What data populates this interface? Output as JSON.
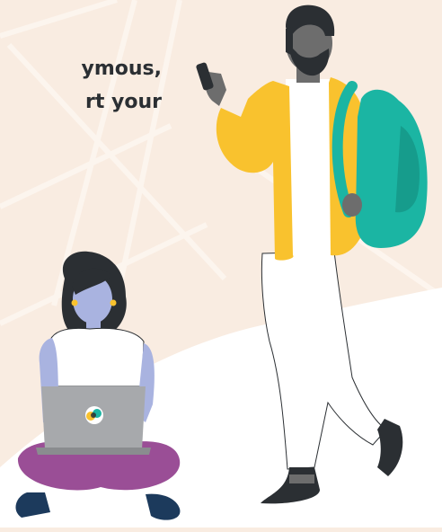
{
  "hero": {
    "text_line_1": "ymous,",
    "text_line_2": "rt your"
  },
  "colors": {
    "background": "#f9ece1",
    "ground": "#ffffff",
    "jacket": "#f9c22e",
    "backpack": "#1bb5a3",
    "skin_woman": "#a9b3e0",
    "skin_man": "#6d6d6d",
    "pants_woman": "#9a4e96",
    "laptop": "#a7a9ac"
  },
  "icons": {
    "laptop_logo": "chat-bubble-logo-icon"
  }
}
